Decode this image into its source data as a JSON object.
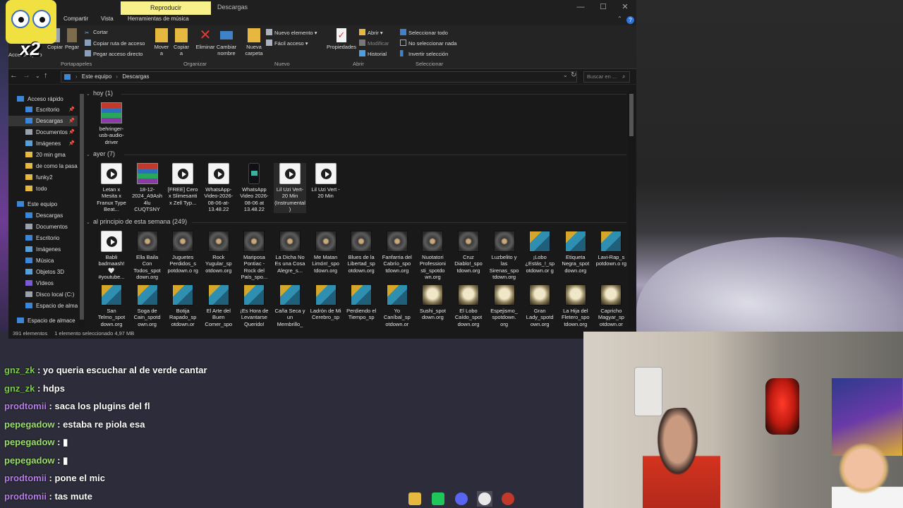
{
  "window": {
    "context_tab_group": "Reproducir",
    "title": "Descargas",
    "minimize": "—",
    "maximize": "☐",
    "close": "✕"
  },
  "ribbon_tabs": [
    "Compartir",
    "Vista",
    "Herramientas de música"
  ],
  "ribbon": {
    "portapapeles": {
      "label": "Portapapeles",
      "copy": "Copiar",
      "paste": "Pegar",
      "cut": "Cortar",
      "copy_path": "Copiar ruta de acceso",
      "paste_shortcut": "Pegar acceso directo",
      "quick_access": "Acceso rápido"
    },
    "organizar": {
      "label": "Organizar",
      "move_to": "Mover a",
      "copy_to": "Copiar a",
      "delete": "Eliminar",
      "rename": "Cambiar nombre"
    },
    "nuevo": {
      "label": "Nuevo",
      "new_folder": "Nueva carpeta",
      "new_item": "Nuevo elemento",
      "easy_access": "Fácil acceso"
    },
    "abrir": {
      "label": "Abrir",
      "properties": "Propiedades",
      "open": "Abrir",
      "edit": "Modificar",
      "history": "Historial"
    },
    "seleccionar": {
      "label": "Seleccionar",
      "select_all": "Seleccionar todo",
      "select_none": "No seleccionar nada",
      "invert": "Invertir selección"
    }
  },
  "address": {
    "crumbs": [
      "Este equipo",
      "Descargas"
    ],
    "search_placeholder": "Buscar en ..."
  },
  "nav_pane": {
    "items": [
      {
        "label": "Acceso rápido",
        "pinned": false,
        "selected": false
      },
      {
        "label": "Escritorio",
        "pinned": true,
        "selected": false
      },
      {
        "label": "Descargas",
        "pinned": true,
        "selected": true
      },
      {
        "label": "Documentos",
        "pinned": true,
        "selected": false
      },
      {
        "label": "Imágenes",
        "pinned": true,
        "selected": false
      },
      {
        "label": "20 min gma",
        "pinned": false,
        "selected": false
      },
      {
        "label": "de como la pasal",
        "pinned": false,
        "selected": false
      },
      {
        "label": "funky2",
        "pinned": false,
        "selected": false
      },
      {
        "label": "todo",
        "pinned": false,
        "selected": false
      },
      {
        "label": "Este equipo",
        "pinned": false,
        "selected": false
      },
      {
        "label": "Descargas",
        "pinned": false,
        "selected": false
      },
      {
        "label": "Documentos",
        "pinned": false,
        "selected": false
      },
      {
        "label": "Escritorio",
        "pinned": false,
        "selected": false
      },
      {
        "label": "Imágenes",
        "pinned": false,
        "selected": false
      },
      {
        "label": "Música",
        "pinned": false,
        "selected": false
      },
      {
        "label": "Objetos 3D",
        "pinned": false,
        "selected": false
      },
      {
        "label": "Vídeos",
        "pinned": false,
        "selected": false
      },
      {
        "label": "Disco local (C:)",
        "pinned": false,
        "selected": false
      },
      {
        "label": "Espacio de almac",
        "pinned": false,
        "selected": false
      },
      {
        "label": "Espacio de almace",
        "pinned": false,
        "selected": false
      }
    ]
  },
  "groups": {
    "hoy": {
      "header": "hoy (1)",
      "items": [
        {
          "label": "behringer-usb-audio-driver",
          "icon": "rar"
        }
      ]
    },
    "ayer": {
      "header": "ayer (7)",
      "items": [
        {
          "label": "Letan x Mesita x Franux Type Beat...",
          "icon": "video"
        },
        {
          "label": "18-12-2024_A9Ash4lu CUQTSNY",
          "icon": "rar"
        },
        {
          "label": "[FREE] Cero x Slimesanti x Zell Typ...",
          "icon": "video"
        },
        {
          "label": "WhatsApp-Video-2026-08-06-at-13.48.22",
          "icon": "video"
        },
        {
          "label": "WhatsApp Video 2026-08-06 at 13.48.22",
          "icon": "phone"
        },
        {
          "label": "Lil Uzi Vert-20 Min (Instrumental)",
          "icon": "video"
        },
        {
          "label": "Lil Uzi Vert - 20 Min",
          "icon": "video"
        }
      ]
    },
    "semana": {
      "header": "al principio de esta semana (249)",
      "row1": [
        {
          "label": "Babli badmaash! 🤍 #youtube...",
          "icon": "video"
        },
        {
          "label": "Ella Baila Con Todos_spot down.org",
          "icon": "cover-a"
        },
        {
          "label": "Juguetes Perdidos_s potdown.o rg",
          "icon": "cover-a"
        },
        {
          "label": "Rock Yugular_sp otdown.org",
          "icon": "cover-a"
        },
        {
          "label": "Mariposa Pontiac - Rock del País_spo...",
          "icon": "cover-a"
        },
        {
          "label": "La Dicha No Es una Cosa Alegre_s...",
          "icon": "cover-a"
        },
        {
          "label": "Me Matan Limón!_spo tdown.org",
          "icon": "cover-a"
        },
        {
          "label": "Blues de la Libertad_sp otdown.org",
          "icon": "cover-a"
        },
        {
          "label": "Fanfarria del Cabrío_spo tdown.org",
          "icon": "cover-a"
        },
        {
          "label": "Nuotatori Professioni sti_spotdo wn.org",
          "icon": "cover-a"
        },
        {
          "label": "Cruz Diablo!_spo tdown.org",
          "icon": "cover-a"
        },
        {
          "label": "Luzbelito y las Sirenas_spo tdown.org",
          "icon": "cover-a"
        },
        {
          "label": "¡Lobo ¿Estás_!_sp otdown.or g",
          "icon": "cover-b"
        },
        {
          "label": "Etiqueta Negra_spot down.org",
          "icon": "cover-b"
        },
        {
          "label": "Lavi-Rap_s potdown.o rg",
          "icon": "cover-b"
        }
      ],
      "row2": [
        {
          "label": "San Telmo_spot down.org",
          "icon": "cover-b"
        },
        {
          "label": "Soga de Cain_spotd own.org",
          "icon": "cover-b"
        },
        {
          "label": "Botija Rapado_sp otdown.or",
          "icon": "cover-b"
        },
        {
          "label": "El Arte del Buen Comer_spo",
          "icon": "cover-b"
        },
        {
          "label": "¡Es Hora de Levantarse Querido!",
          "icon": "cover-b"
        },
        {
          "label": "Caña Seca y un Membrillo_",
          "icon": "cover-b"
        },
        {
          "label": "Ladrón de Mi Cerebro_sp",
          "icon": "cover-b"
        },
        {
          "label": "Perdiendo el Tiempo_sp",
          "icon": "cover-b"
        },
        {
          "label": "Yo Caníbal_sp otdown.or",
          "icon": "cover-b"
        },
        {
          "label": "Sushi_spot down.org",
          "icon": "cover-c"
        },
        {
          "label": "El Lobo Caído_spot down.org",
          "icon": "cover-c"
        },
        {
          "label": "Espejismo_ spotdown. org",
          "icon": "cover-c"
        },
        {
          "label": "Gran Lady_spotd own.org",
          "icon": "cover-c"
        },
        {
          "label": "La Hija del Fletero_spo tdown.org",
          "icon": "cover-c"
        },
        {
          "label": "Capricho Magyar_sp otdown.or",
          "icon": "cover-c"
        }
      ]
    }
  },
  "status": {
    "count": "391 elementos",
    "selection": "1 elemento seleccionado  4,97 MB"
  },
  "chat": [
    {
      "user": "gnz_zk",
      "color": "#7ecb4a",
      "message": "yo queria escuchar al de verde cantar"
    },
    {
      "user": "gnz_zk",
      "color": "#7ecb4a",
      "message": "hdps"
    },
    {
      "user": "prodtomii",
      "color": "#b57ee8",
      "message": "saca los plugins del fl"
    },
    {
      "user": "pepegadow",
      "color": "#9be06a",
      "message": "estaba re piola esa"
    },
    {
      "user": "pepegadow",
      "color": "#9be06a",
      "message": "▮"
    },
    {
      "user": "pepegadow",
      "color": "#9be06a",
      "message": "▮"
    },
    {
      "user": "prodtomii",
      "color": "#b57ee8",
      "message": "pone el mic"
    },
    {
      "user": "prodtomii",
      "color": "#b57ee8",
      "message": "tas mute"
    }
  ],
  "sticker_text": "x2",
  "taskbar_icons": [
    "folder-icon",
    "game-icon",
    "discord-icon",
    "chrome-icon",
    "recorder-icon"
  ]
}
